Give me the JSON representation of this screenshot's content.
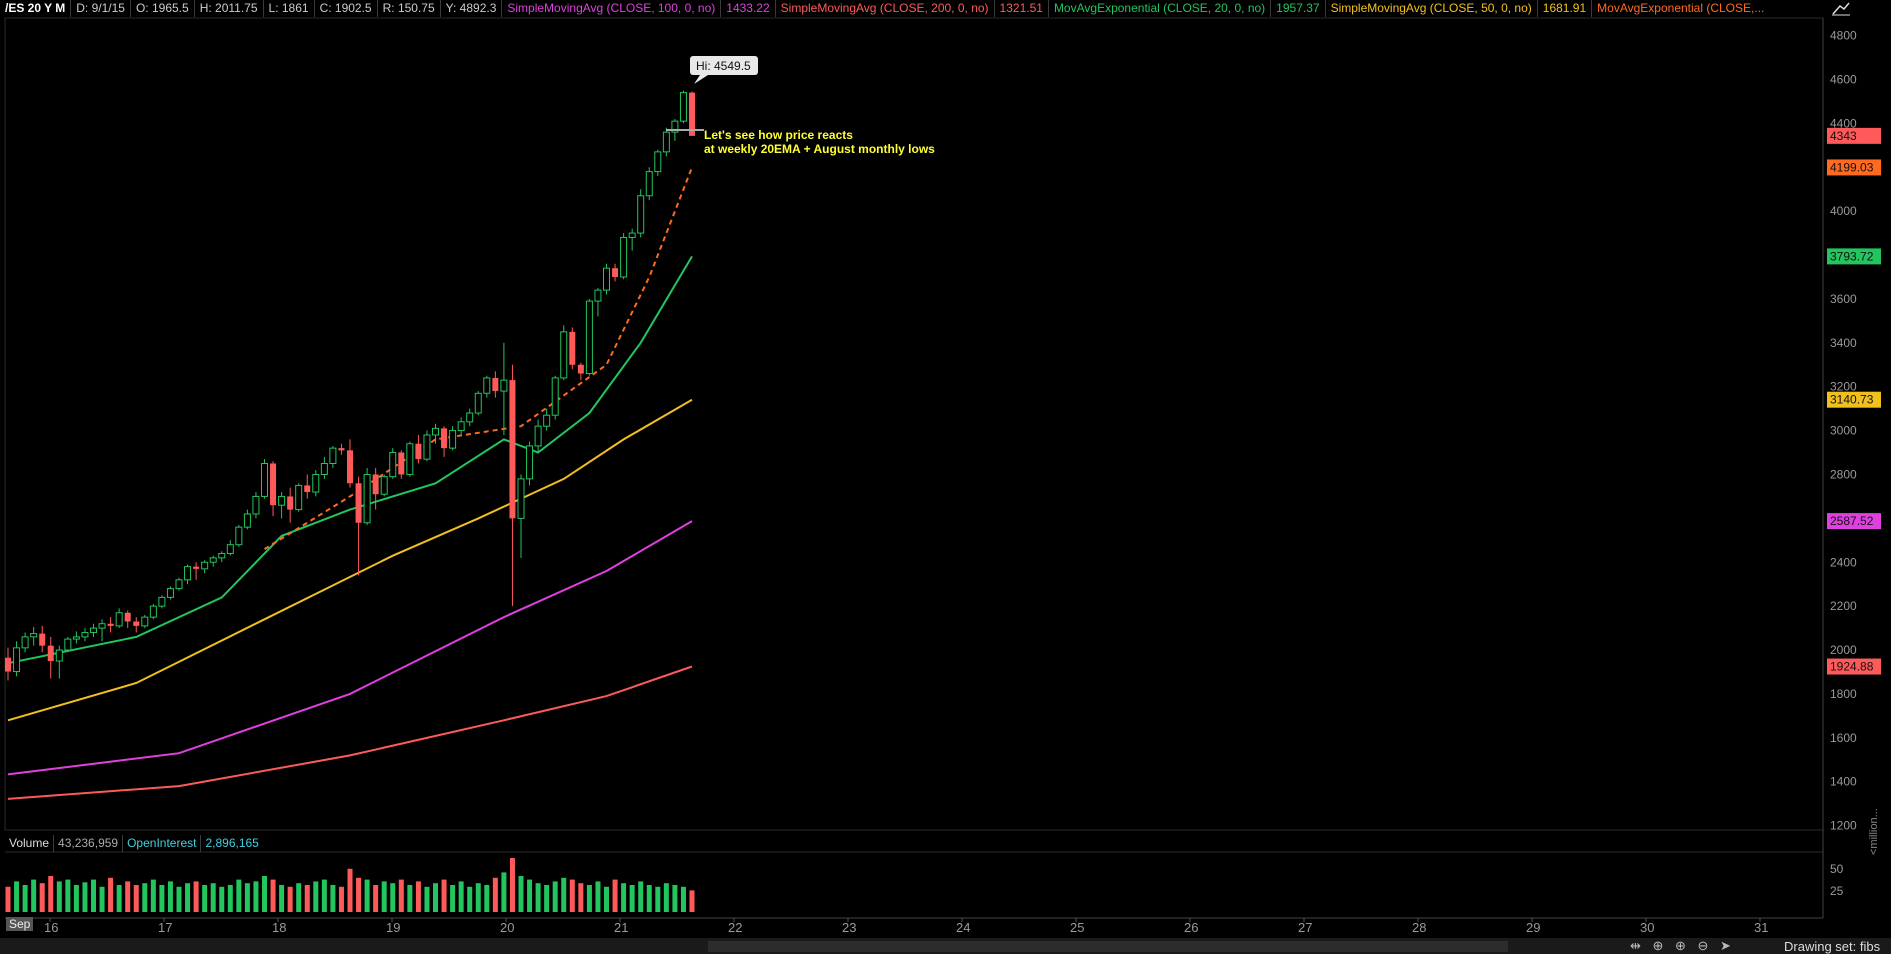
{
  "header": {
    "symbol": "/ES 20 Y M",
    "date": "D: 9/1/15",
    "open": "O: 1965.5",
    "high": "H: 2011.75",
    "low": "L: 1861",
    "close": "C: 1902.5",
    "range": "R: 150.75",
    "y": "Y: 4892.3",
    "studies": [
      {
        "label": "SimpleMovingAvg (CLOSE, 100, 0, no)",
        "value": "1433.22",
        "color": "#e040e0"
      },
      {
        "label": "SimpleMovingAvg (CLOSE, 200, 0, no)",
        "value": "1321.51",
        "color": "#ff5a5a"
      },
      {
        "label": "MovAvgExponential (CLOSE, 20, 0, no)",
        "value": "1957.37",
        "color": "#22c55e"
      },
      {
        "label": "SimpleMovingAvg (CLOSE, 50, 0, no)",
        "value": "1681.91",
        "color": "#f2c01e"
      },
      {
        "label": "MovAvgExponential (CLOSE,...",
        "value": "",
        "color": "#ff6a20"
      }
    ]
  },
  "annotation": {
    "hi_label": "Hi: 4549.5",
    "note_line1": "Let's see how price reacts",
    "note_line2": "at weekly 20EMA + August monthly lows",
    "note_color": "#ffff33"
  },
  "price_badges": [
    {
      "text": "4343",
      "value": 4343,
      "color": "#ff5a5a"
    },
    {
      "text": "4199.03",
      "value": 4199.03,
      "color": "#ff6a20"
    },
    {
      "text": "3793.72",
      "value": 3793.72,
      "color": "#22c55e"
    },
    {
      "text": "3140.73",
      "value": 3140.73,
      "color": "#f2c01e"
    },
    {
      "text": "2587.52",
      "value": 2587.52,
      "color": "#e040e0"
    },
    {
      "text": "1924.88",
      "value": 1924.88,
      "color": "#ff5a5a"
    }
  ],
  "volume_panel": {
    "volume_label": "Volume",
    "volume_value": "43,236,959",
    "oi_label": "OpenInterest",
    "oi_value": "2,896,165",
    "axis_ticks": [
      "50",
      "25"
    ],
    "unit_label": "<million..."
  },
  "footer": {
    "month_label": "Sep",
    "drawing_set": "Drawing set: fibs",
    "tools": "⇹ ⊕ ⊕ ⊖ ➤"
  },
  "chart_data": {
    "type": "candlestick",
    "x_tick_labels": [
      "16",
      "17",
      "18",
      "19",
      "20",
      "21",
      "22",
      "23",
      "24",
      "25",
      "26",
      "27",
      "28",
      "29",
      "30",
      "31"
    ],
    "y_ticks": [
      1200,
      1400,
      1600,
      1800,
      2000,
      2200,
      2400,
      2600,
      2800,
      3000,
      3200,
      3400,
      3600,
      3800,
      4000,
      4200,
      4400,
      4600,
      4800
    ],
    "ylim": [
      1180,
      4880
    ],
    "candles": [
      [
        1965,
        2011,
        1861,
        1902
      ],
      [
        1902,
        2040,
        1880,
        2010
      ],
      [
        2010,
        2080,
        1990,
        2060
      ],
      [
        2060,
        2105,
        2020,
        2075
      ],
      [
        2075,
        2110,
        1990,
        2020
      ],
      [
        2020,
        2060,
        1870,
        1950
      ],
      [
        1950,
        2020,
        1870,
        2000
      ],
      [
        2000,
        2060,
        1990,
        2050
      ],
      [
        2050,
        2085,
        2030,
        2060
      ],
      [
        2060,
        2100,
        2040,
        2080
      ],
      [
        2080,
        2120,
        2060,
        2100
      ],
      [
        2100,
        2140,
        2040,
        2120
      ],
      [
        2120,
        2150,
        2080,
        2110
      ],
      [
        2110,
        2190,
        2100,
        2170
      ],
      [
        2170,
        2180,
        2100,
        2130
      ],
      [
        2130,
        2150,
        2080,
        2110
      ],
      [
        2110,
        2160,
        2100,
        2150
      ],
      [
        2150,
        2210,
        2140,
        2200
      ],
      [
        2200,
        2250,
        2190,
        2240
      ],
      [
        2240,
        2290,
        2230,
        2280
      ],
      [
        2280,
        2330,
        2270,
        2320
      ],
      [
        2320,
        2390,
        2300,
        2380
      ],
      [
        2380,
        2400,
        2320,
        2370
      ],
      [
        2370,
        2410,
        2350,
        2400
      ],
      [
        2400,
        2430,
        2380,
        2420
      ],
      [
        2420,
        2450,
        2400,
        2440
      ],
      [
        2440,
        2500,
        2430,
        2480
      ],
      [
        2480,
        2570,
        2470,
        2560
      ],
      [
        2560,
        2640,
        2550,
        2620
      ],
      [
        2620,
        2720,
        2600,
        2700
      ],
      [
        2700,
        2870,
        2690,
        2850
      ],
      [
        2850,
        2860,
        2610,
        2660
      ],
      [
        2660,
        2720,
        2600,
        2700
      ],
      [
        2700,
        2740,
        2580,
        2640
      ],
      [
        2640,
        2760,
        2630,
        2750
      ],
      [
        2750,
        2800,
        2690,
        2720
      ],
      [
        2720,
        2820,
        2700,
        2800
      ],
      [
        2800,
        2880,
        2780,
        2850
      ],
      [
        2850,
        2930,
        2830,
        2920
      ],
      [
        2920,
        2940,
        2890,
        2910
      ],
      [
        2910,
        2960,
        2740,
        2760
      ],
      [
        2760,
        2790,
        2340,
        2580
      ],
      [
        2580,
        2830,
        2570,
        2800
      ],
      [
        2800,
        2830,
        2640,
        2710
      ],
      [
        2710,
        2800,
        2700,
        2790
      ],
      [
        2790,
        2920,
        2780,
        2900
      ],
      [
        2900,
        2910,
        2780,
        2800
      ],
      [
        2800,
        2950,
        2790,
        2940
      ],
      [
        2940,
        2980,
        2850,
        2870
      ],
      [
        2870,
        3000,
        2860,
        2980
      ],
      [
        2980,
        3030,
        2940,
        3010
      ],
      [
        3010,
        3020,
        2880,
        2920
      ],
      [
        2920,
        3020,
        2910,
        3000
      ],
      [
        3000,
        3060,
        2980,
        3040
      ],
      [
        3040,
        3100,
        3020,
        3080
      ],
      [
        3080,
        3180,
        3070,
        3170
      ],
      [
        3170,
        3250,
        3150,
        3240
      ],
      [
        3240,
        3270,
        3150,
        3180
      ],
      [
        3180,
        3400,
        2980,
        3230
      ],
      [
        3230,
        3300,
        2200,
        2600
      ],
      [
        2600,
        2800,
        2420,
        2780
      ],
      [
        2780,
        2950,
        2750,
        2930
      ],
      [
        2930,
        3050,
        2900,
        3020
      ],
      [
        3020,
        3100,
        3000,
        3070
      ],
      [
        3070,
        3250,
        3050,
        3240
      ],
      [
        3240,
        3480,
        3230,
        3450
      ],
      [
        3450,
        3470,
        3280,
        3300
      ],
      [
        3300,
        3310,
        3230,
        3260
      ],
      [
        3260,
        3600,
        3250,
        3590
      ],
      [
        3590,
        3650,
        3520,
        3640
      ],
      [
        3640,
        3760,
        3620,
        3740
      ],
      [
        3740,
        3760,
        3680,
        3700
      ],
      [
        3700,
        3900,
        3690,
        3880
      ],
      [
        3880,
        3920,
        3820,
        3900
      ],
      [
        3900,
        4100,
        3880,
        4070
      ],
      [
        4070,
        4200,
        4050,
        4180
      ],
      [
        4180,
        4280,
        4160,
        4270
      ],
      [
        4270,
        4380,
        4250,
        4360
      ],
      [
        4360,
        4420,
        4320,
        4410
      ],
      [
        4410,
        4549.5,
        4400,
        4540
      ],
      [
        4540,
        4545,
        4343,
        4343
      ]
    ],
    "ema_10_dashed": [
      [
        30,
        2460
      ],
      [
        40,
        2700
      ],
      [
        50,
        2960
      ],
      [
        60,
        3020
      ],
      [
        70,
        3300
      ],
      [
        75,
        3700
      ],
      [
        80,
        4199.03
      ]
    ],
    "ema_20": [
      [
        0,
        1940
      ],
      [
        15,
        2060
      ],
      [
        25,
        2240
      ],
      [
        32,
        2520
      ],
      [
        40,
        2640
      ],
      [
        50,
        2760
      ],
      [
        58,
        2960
      ],
      [
        62,
        2900
      ],
      [
        68,
        3080
      ],
      [
        74,
        3400
      ],
      [
        80,
        3793.72
      ]
    ],
    "sma_50": [
      [
        0,
        1680
      ],
      [
        15,
        1850
      ],
      [
        30,
        2140
      ],
      [
        45,
        2430
      ],
      [
        55,
        2600
      ],
      [
        65,
        2780
      ],
      [
        72,
        2960
      ],
      [
        80,
        3140.73
      ]
    ],
    "sma_100": [
      [
        0,
        1433.22
      ],
      [
        20,
        1530
      ],
      [
        40,
        1800
      ],
      [
        58,
        2150
      ],
      [
        70,
        2360
      ],
      [
        80,
        2587.52
      ]
    ],
    "sma_200": [
      [
        0,
        1321.51
      ],
      [
        20,
        1380
      ],
      [
        40,
        1520
      ],
      [
        58,
        1680
      ],
      [
        70,
        1790
      ],
      [
        80,
        1924.88
      ]
    ],
    "volume": [
      28,
      34,
      30,
      36,
      32,
      40,
      34,
      36,
      30,
      33,
      36,
      28,
      38,
      30,
      34,
      30,
      32,
      36,
      30,
      34,
      28,
      32,
      34,
      30,
      32,
      28,
      30,
      36,
      32,
      34,
      40,
      36,
      30,
      28,
      32,
      30,
      34,
      36,
      30,
      28,
      48,
      38,
      36,
      30,
      34,
      32,
      36,
      30,
      34,
      28,
      32,
      36,
      30,
      34,
      28,
      32,
      30,
      38,
      44,
      60,
      40,
      36,
      32,
      30,
      34,
      38,
      36,
      32,
      30,
      34,
      28,
      36,
      32,
      30,
      34,
      30,
      28,
      32,
      30,
      28,
      24
    ]
  }
}
